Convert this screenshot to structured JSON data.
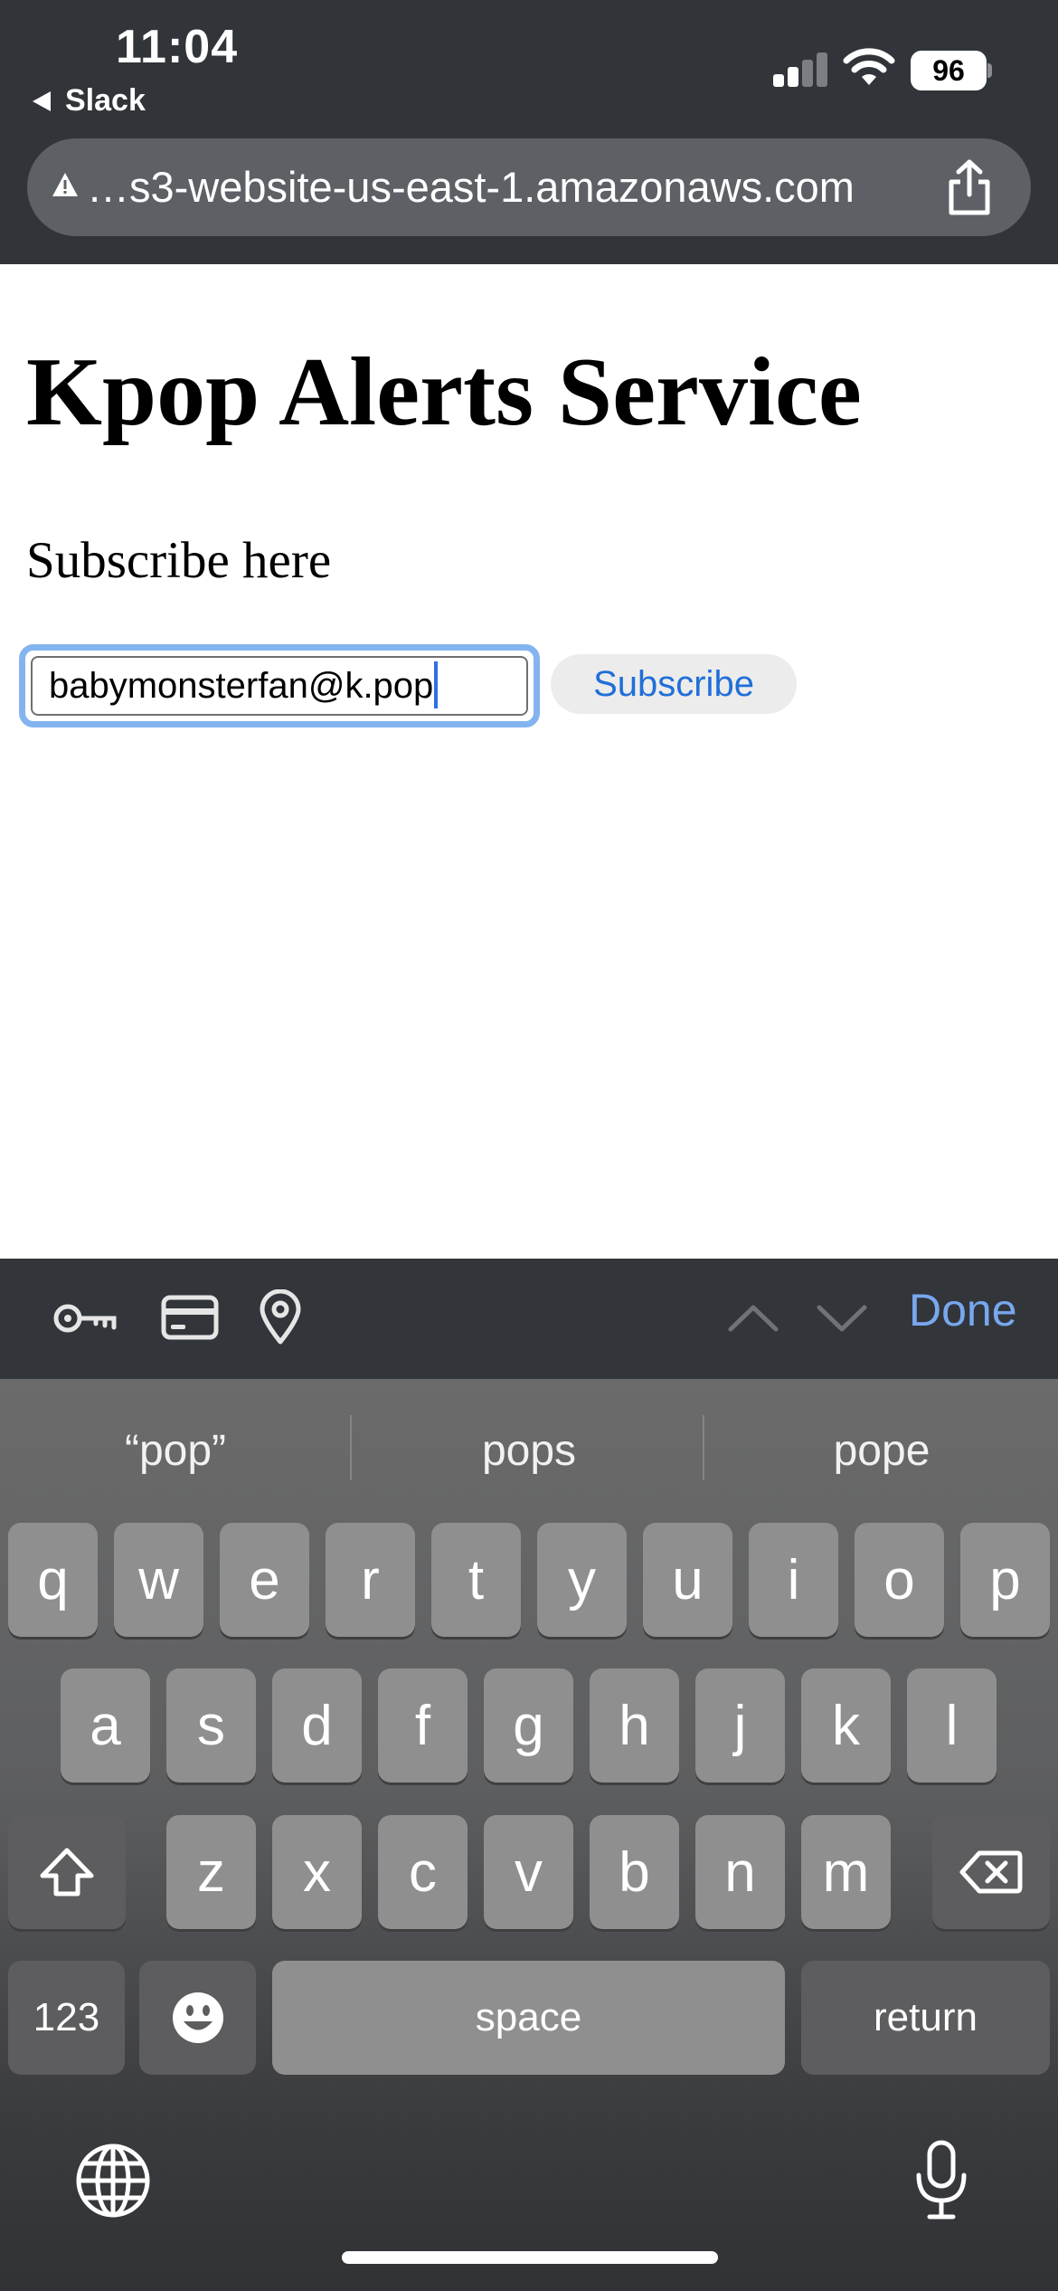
{
  "status_bar": {
    "time": "11:04",
    "back_app": "Slack",
    "battery": "96",
    "signal_bars_active": 2,
    "signal_bars_total": 4
  },
  "browser": {
    "url": "…s3-website-us-east-1.amazonaws.com",
    "warning_icon": "warning-triangle-icon",
    "share_icon": "share-icon"
  },
  "page": {
    "title": "Kpop Alerts Service",
    "subheading": "Subscribe here",
    "email_value": "babymonsterfan@k.pop",
    "subscribe_label": "Subscribe"
  },
  "accessory_bar": {
    "icons": [
      "key-icon",
      "credit-card-icon",
      "location-pin-icon",
      "chevron-up-icon",
      "chevron-down-icon"
    ],
    "done_label": "Done"
  },
  "keyboard": {
    "suggestions": [
      "“pop”",
      "pops",
      "pope"
    ],
    "row1": [
      "q",
      "w",
      "e",
      "r",
      "t",
      "y",
      "u",
      "i",
      "o",
      "p"
    ],
    "row2": [
      "a",
      "s",
      "d",
      "f",
      "g",
      "h",
      "j",
      "k",
      "l"
    ],
    "row3": [
      "z",
      "x",
      "c",
      "v",
      "b",
      "n",
      "m"
    ],
    "numbers_label": "123",
    "space_label": "space",
    "return_label": "return"
  },
  "colors": {
    "chrome_bg": "#31353a",
    "link_blue": "#1f6fd8",
    "focus_ring": "#84b4ef",
    "done_blue": "#78a8ee"
  }
}
